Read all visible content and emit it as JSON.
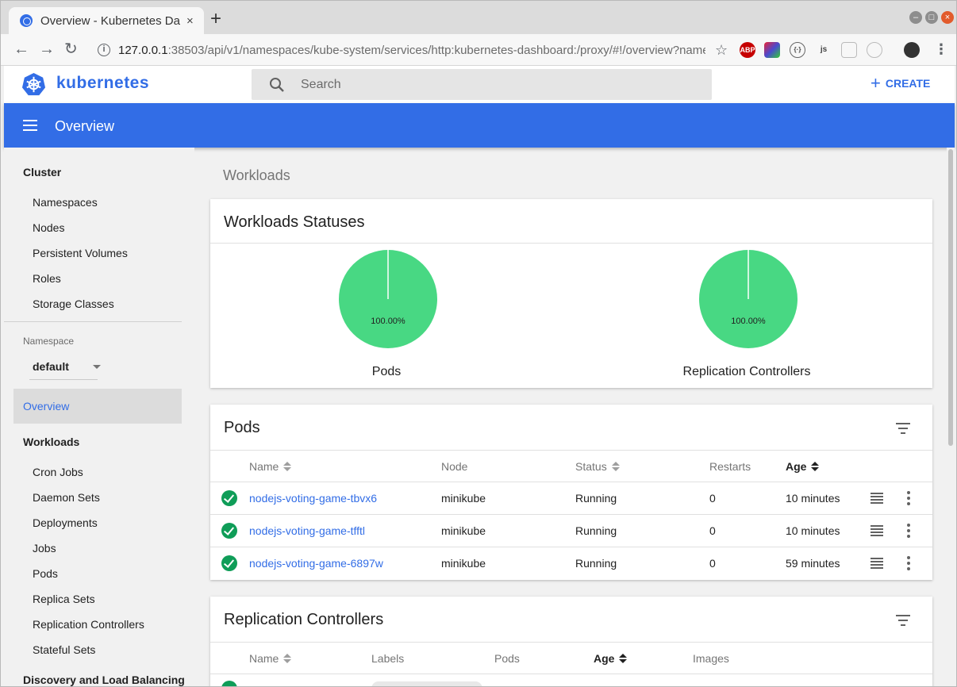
{
  "browser": {
    "tab_title": "Overview - Kubernetes Da",
    "tab_close": "×",
    "new_tab": "+",
    "url_host": "127.0.0.1",
    "url_rest": ":38503/api/v1/namespaces/kube-system/services/http:kubernetes-dashboard:/proxy/#!/overview?names…",
    "extensions": [
      {
        "name": "adblock-icon",
        "text": "ABP",
        "color": "#c60000"
      },
      {
        "name": "color-picker-icon",
        "text": "",
        "color": "#5a5acb"
      },
      {
        "name": "code-extension-icon",
        "text": "{·}",
        "color": "#ffffff"
      },
      {
        "name": "js-extension-icon",
        "text": "js",
        "color": "#ffffff"
      },
      {
        "name": "grid-extension-icon",
        "text": "",
        "color": "#ffffff"
      },
      {
        "name": "record-extension-icon",
        "text": "",
        "color": "#ffffff"
      }
    ]
  },
  "header": {
    "brand": "kubernetes",
    "search_placeholder": "Search",
    "create_label": "CREATE",
    "accent": "#326de6"
  },
  "appbar": {
    "title": "Overview"
  },
  "sidebar": {
    "cluster_heading": "Cluster",
    "cluster_items": [
      "Namespaces",
      "Nodes",
      "Persistent Volumes",
      "Roles",
      "Storage Classes"
    ],
    "namespace_label": "Namespace",
    "namespace_value": "default",
    "active_item": "Overview",
    "workloads_heading": "Workloads",
    "workloads_items": [
      "Cron Jobs",
      "Daemon Sets",
      "Deployments",
      "Jobs",
      "Pods",
      "Replica Sets",
      "Replication Controllers",
      "Stateful Sets"
    ],
    "discovery_heading": "Discovery and Load Balancing"
  },
  "main": {
    "section_title": "Workloads",
    "statuses": {
      "title": "Workloads Statuses",
      "charts": [
        {
          "label": "Pods",
          "percent_text": "100.00%",
          "running_fraction": 1.0,
          "color": "#48d883"
        },
        {
          "label": "Replication Controllers",
          "percent_text": "100.00%",
          "running_fraction": 1.0,
          "color": "#48d883"
        }
      ]
    },
    "pods": {
      "title": "Pods",
      "columns": {
        "name": "Name",
        "node": "Node",
        "status": "Status",
        "restarts": "Restarts",
        "age": "Age"
      },
      "rows": [
        {
          "name": "nodejs-voting-game-tbvx6",
          "node": "minikube",
          "status": "Running",
          "restarts": "0",
          "age": "10 minutes"
        },
        {
          "name": "nodejs-voting-game-tfftl",
          "node": "minikube",
          "status": "Running",
          "restarts": "0",
          "age": "10 minutes"
        },
        {
          "name": "nodejs-voting-game-6897w",
          "node": "minikube",
          "status": "Running",
          "restarts": "0",
          "age": "59 minutes"
        }
      ]
    },
    "replication_controllers": {
      "title": "Replication Controllers",
      "columns": {
        "name": "Name",
        "labels": "Labels",
        "pods": "Pods",
        "age": "Age",
        "images": "Images"
      }
    }
  }
}
